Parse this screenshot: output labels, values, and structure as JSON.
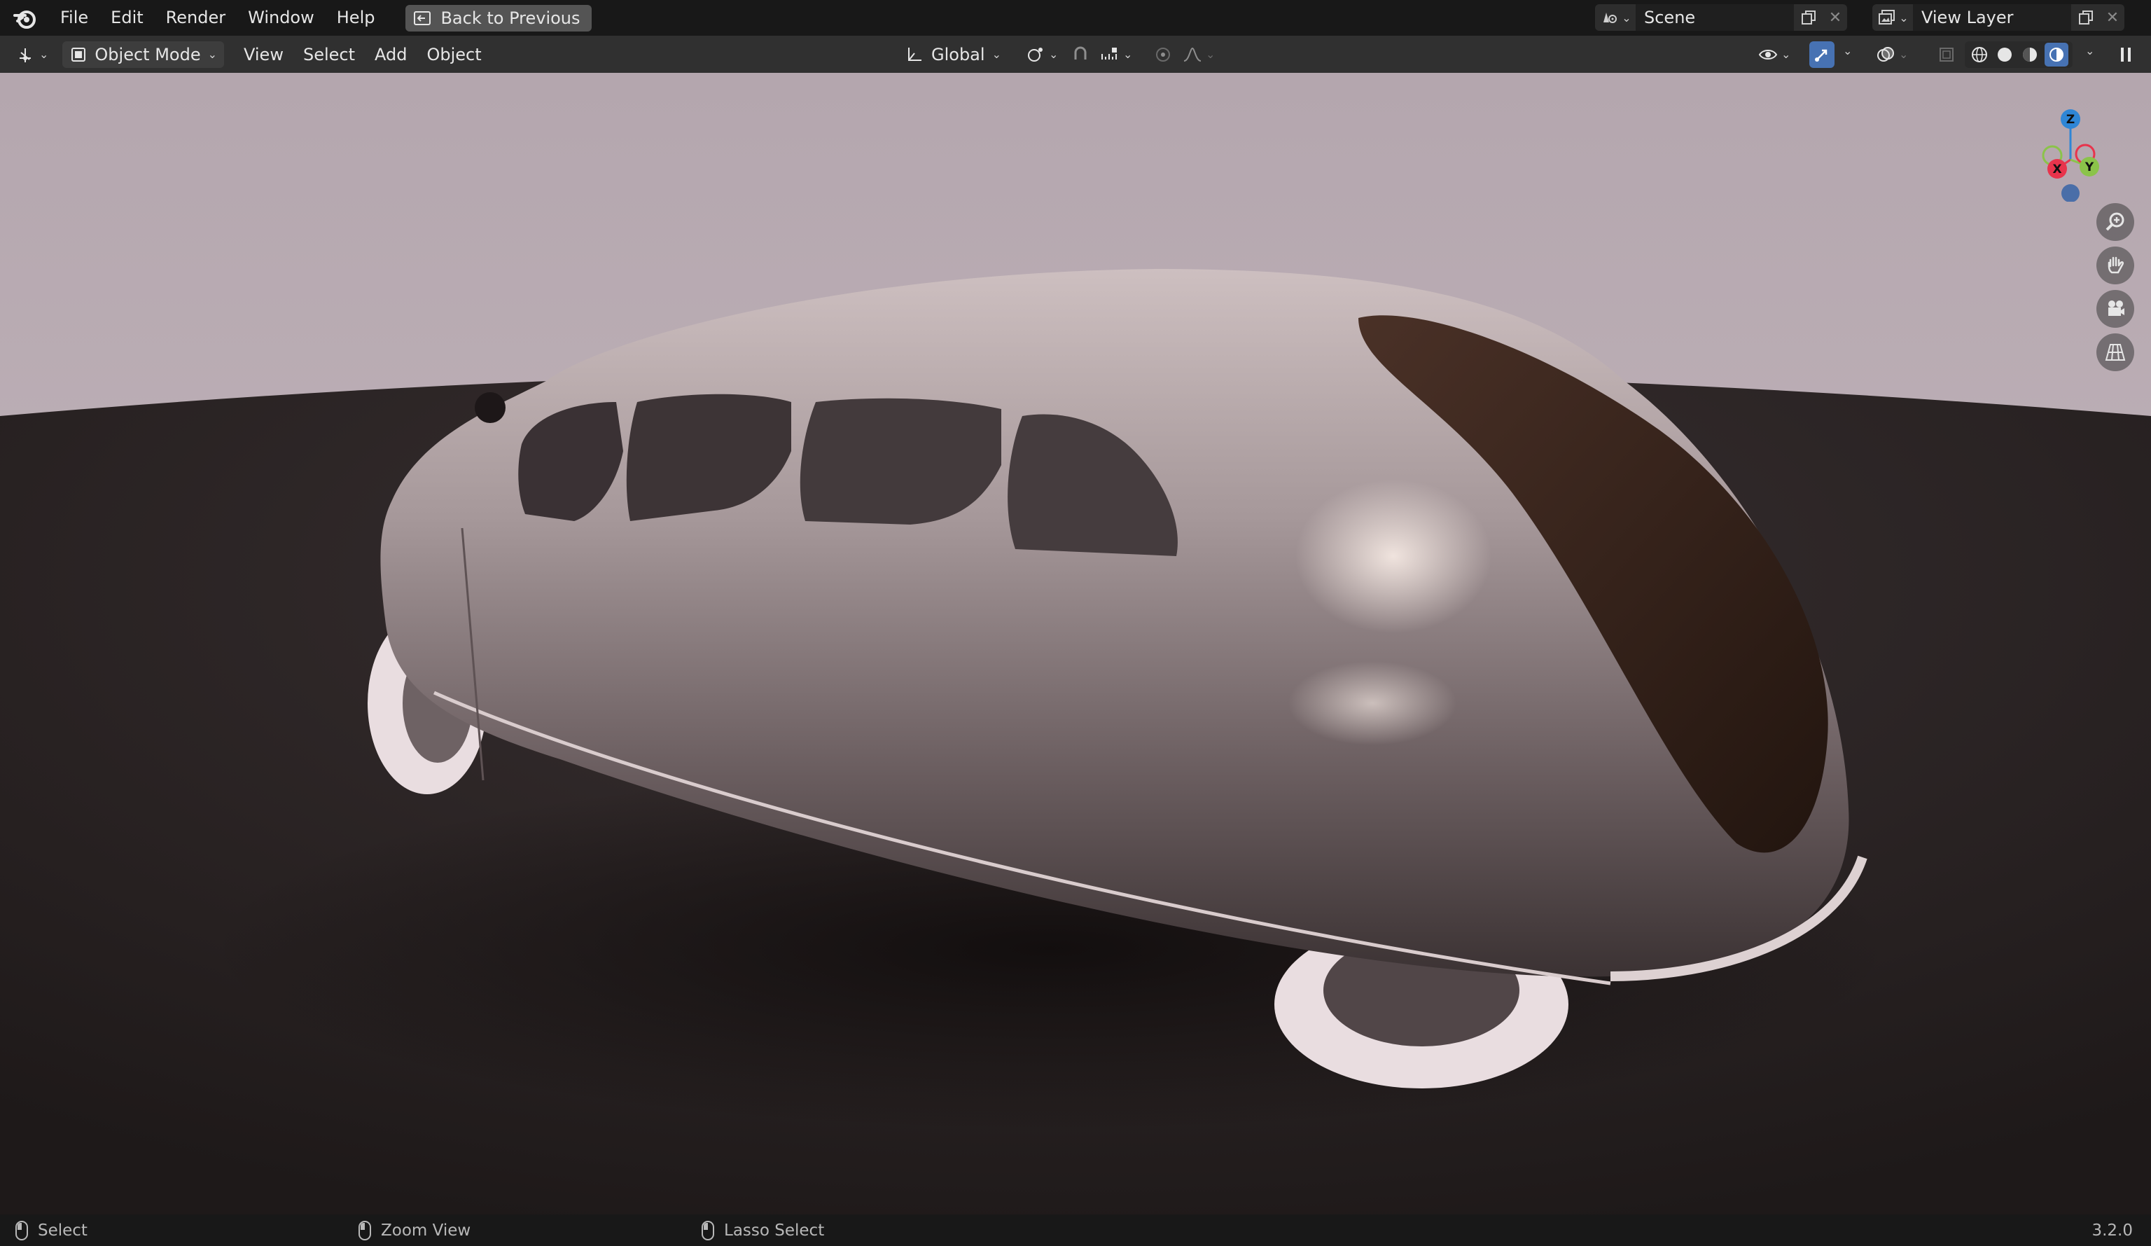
{
  "app": {
    "name": "Blender"
  },
  "topbar": {
    "menus": [
      "File",
      "Edit",
      "Render",
      "Window",
      "Help"
    ],
    "back_button": "Back to Previous",
    "scene": {
      "label": "Scene",
      "value": "Scene"
    },
    "view_layer": {
      "label": "View Layer",
      "value": "View Layer"
    }
  },
  "header": {
    "mode": "Object Mode",
    "menus": [
      "View",
      "Select",
      "Add",
      "Object"
    ],
    "transform_orientation": "Global"
  },
  "viewport": {
    "gizmo_axes": {
      "z": "Z",
      "y": "Y",
      "x": "X"
    },
    "colors": {
      "background": "#b7a9b1",
      "floor": "#2a2324",
      "car_body": "#a89a9c",
      "axis_x": "#e8344c",
      "axis_y": "#8bc34a",
      "axis_z": "#2f86d6"
    }
  },
  "statusbar": {
    "items": [
      "Select",
      "Zoom View",
      "Lasso Select"
    ],
    "version": "3.2.0"
  }
}
